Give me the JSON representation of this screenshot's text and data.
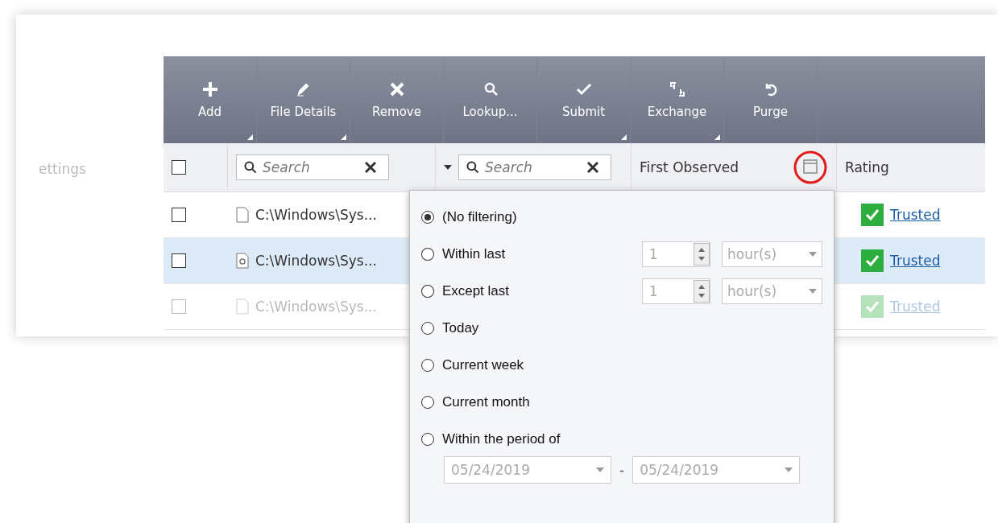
{
  "sidebar_fragment": "ettings",
  "toolbar": [
    {
      "label": "Add",
      "menu": true
    },
    {
      "label": "File Details",
      "menu": true
    },
    {
      "label": "Remove",
      "menu": false
    },
    {
      "label": "Lookup...",
      "menu": false
    },
    {
      "label": "Submit",
      "menu": true
    },
    {
      "label": "Exchange",
      "menu": true
    },
    {
      "label": "Purge",
      "menu": false
    }
  ],
  "header": {
    "select_all_checked": false,
    "search_1": {
      "placeholder": "Search"
    },
    "search_2": {
      "placeholder": "Search"
    },
    "first_observed": "First Observed",
    "rating": "Rating",
    "calendar_highlighted": true
  },
  "rows": [
    {
      "path": "C:\\Windows\\Sys...",
      "checked": false,
      "selected": false,
      "kind": "file",
      "rating": "Trusted",
      "faded": false
    },
    {
      "path": "C:\\Windows\\Sys...",
      "checked": false,
      "selected": true,
      "kind": "settings-file",
      "rating": "Trusted",
      "faded": false
    },
    {
      "path": "C:\\Windows\\Sys...",
      "checked": false,
      "selected": false,
      "kind": "file",
      "rating": "Trusted",
      "faded": true
    }
  ],
  "filter_menu": {
    "options": [
      {
        "label": "(No filtering)",
        "selected": true,
        "kind": "plain"
      },
      {
        "label": "Within last",
        "selected": false,
        "kind": "span",
        "value": "1",
        "unit": "hour(s)"
      },
      {
        "label": "Except last",
        "selected": false,
        "kind": "span",
        "value": "1",
        "unit": "hour(s)"
      },
      {
        "label": "Today",
        "selected": false,
        "kind": "plain"
      },
      {
        "label": "Current week",
        "selected": false,
        "kind": "plain"
      },
      {
        "label": "Current month",
        "selected": false,
        "kind": "plain"
      },
      {
        "label": "Within the period of",
        "selected": false,
        "kind": "period",
        "from": "05/24/2019",
        "to": "05/24/2019",
        "separator": "-"
      }
    ]
  }
}
